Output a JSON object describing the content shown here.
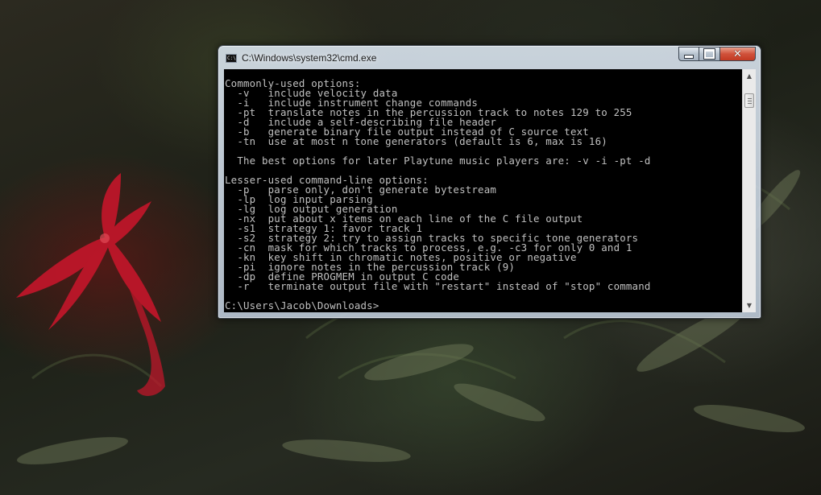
{
  "window": {
    "title": "C:\\Windows\\system32\\cmd.exe",
    "icon": "console-icon",
    "icon_label": "C:\\"
  },
  "caption_buttons": {
    "minimize": "minimize-icon",
    "maximize": "maximize-icon",
    "close_label": "✕"
  },
  "console": {
    "lines": [
      "Commonly-used options:",
      "  -v   include velocity data",
      "  -i   include instrument change commands",
      "  -pt  translate notes in the percussion track to notes 129 to 255",
      "  -d   include a self-describing file header",
      "  -b   generate binary file output instead of C source text",
      "  -tn  use at most n tone generators (default is 6, max is 16)",
      "",
      "  The best options for later Playtune music players are: -v -i -pt -d",
      "",
      "Lesser-used command-line options:",
      "  -p   parse only, don't generate bytestream",
      "  -lp  log input parsing",
      "  -lg  log output generation",
      "  -nx  put about x items on each line of the C file output",
      "  -s1  strategy 1: favor track 1",
      "  -s2  strategy 2: try to assign tracks to specific tone generators",
      "  -cn  mask for which tracks to process, e.g. -c3 for only 0 and 1",
      "  -kn  key shift in chromatic notes, positive or negative",
      "  -pi  ignore notes in the percussion track (9)",
      "  -dp  define PROGMEM in output C code",
      "  -r   terminate output file with \"restart\" instead of \"stop\" command",
      "",
      "C:\\Users\\Jacob\\Downloads>"
    ]
  },
  "scrollbar": {
    "up_arrow": "▲",
    "down_arrow": "▼"
  }
}
